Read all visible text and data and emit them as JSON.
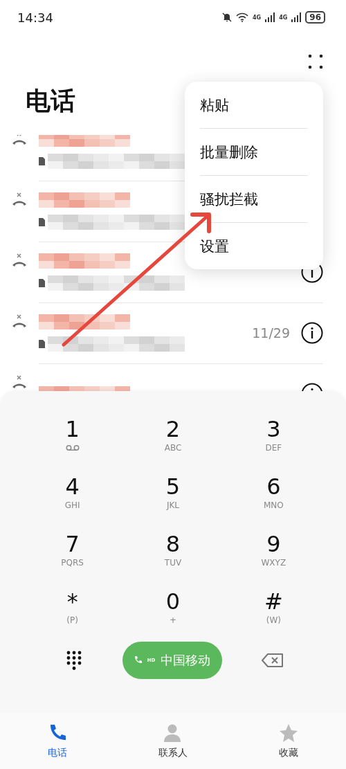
{
  "status_bar": {
    "time": "14:34",
    "network_1": "4G",
    "network_2": "4G",
    "battery": "96"
  },
  "header": {
    "title": "电话"
  },
  "calls": [
    {
      "missed": true,
      "details": true,
      "info": false
    },
    {
      "missed": true,
      "details": true,
      "info": false
    },
    {
      "missed": true,
      "details": true,
      "info": true
    },
    {
      "missed": true,
      "details": true,
      "date": "11/29",
      "info": true
    },
    {
      "missed": true,
      "details": false,
      "info": true
    }
  ],
  "menu": [
    "粘贴",
    "批量删除",
    "骚扰拦截",
    "设置"
  ],
  "keypad": [
    {
      "digit": "1",
      "kind": "voicemail"
    },
    {
      "digit": "2",
      "kind": "letters",
      "letters": "ABC"
    },
    {
      "digit": "3",
      "kind": "letters",
      "letters": "DEF"
    },
    {
      "digit": "4",
      "kind": "letters",
      "letters": "GHI"
    },
    {
      "digit": "5",
      "kind": "letters",
      "letters": "JKL"
    },
    {
      "digit": "6",
      "kind": "letters",
      "letters": "MNO"
    },
    {
      "digit": "7",
      "kind": "letters",
      "letters": "PQRS"
    },
    {
      "digit": "8",
      "kind": "letters",
      "letters": "TUV"
    },
    {
      "digit": "9",
      "kind": "letters",
      "letters": "WXYZ"
    },
    {
      "digit": "*",
      "kind": "letters",
      "letters": "(P)"
    },
    {
      "digit": "0",
      "kind": "letters",
      "letters": "+"
    },
    {
      "digit": "#",
      "kind": "letters",
      "letters": "(W)"
    }
  ],
  "dial_button": {
    "label": "中国移动",
    "hd_label": "HD"
  },
  "tabs": [
    {
      "label": "电话",
      "selected": true
    },
    {
      "label": "联系人",
      "selected": false
    },
    {
      "label": "收藏",
      "selected": false
    }
  ]
}
